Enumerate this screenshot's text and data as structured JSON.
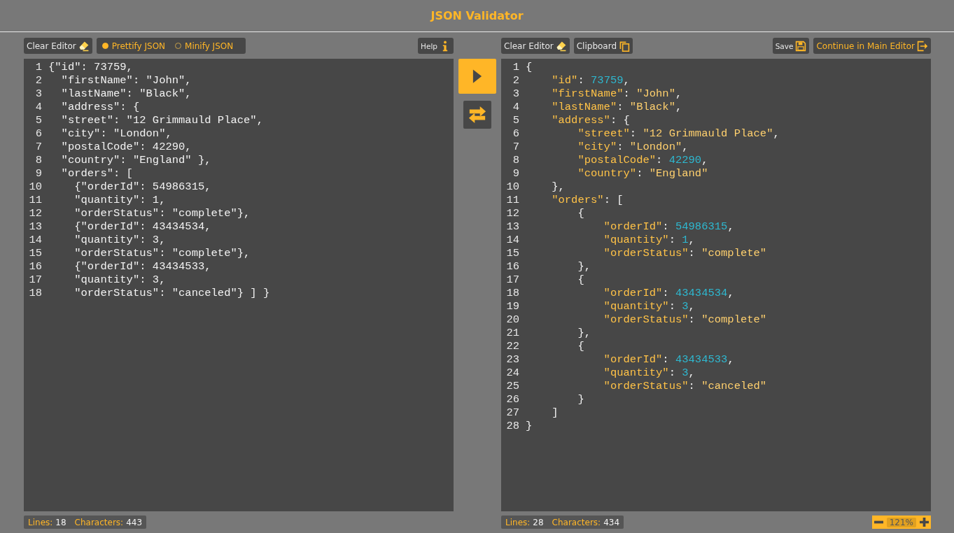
{
  "title": "JSON Validator",
  "left": {
    "toolbar": {
      "clear": "Clear Editor",
      "modes": [
        {
          "label": "Prettify JSON",
          "selected": true
        },
        {
          "label": "Minify JSON",
          "selected": false
        }
      ],
      "help": "Help"
    },
    "lines": [
      "{\"id\": 73759,",
      "  \"firstName\": \"John\",",
      "  \"lastName\": \"Black\",",
      "  \"address\": {",
      "  \"street\": \"12 Grimmauld Place\",",
      "  \"city\": \"London\",",
      "  \"postalCode\": 42290,",
      "  \"country\": \"England\" },",
      "  \"orders\": [",
      "    {\"orderId\": 54986315,",
      "    \"quantity\": 1,",
      "    \"orderStatus\": \"complete\"},",
      "    {\"orderId\": 43434534,",
      "    \"quantity\": 3,",
      "    \"orderStatus\": \"complete\"},",
      "    {\"orderId\": 43434533,",
      "    \"quantity\": 3,",
      "    \"orderStatus\": \"canceled\"} ] }"
    ],
    "line_numbers": [
      "1",
      "2",
      "3",
      "4",
      "5",
      "6",
      "7",
      "8",
      "9",
      "10",
      "11",
      "12",
      "13",
      "14",
      "15",
      "16",
      "17",
      "18"
    ],
    "status": {
      "lines_label": "Lines:",
      "lines": "18",
      "chars_label": "Characters:",
      "chars": "443"
    }
  },
  "right": {
    "toolbar": {
      "clear": "Clear Editor",
      "clipboard": "Clipboard",
      "save": "Save",
      "continue": "Continue in Main Editor"
    },
    "lines": [
      [
        {
          "kind": "punct",
          "text": "{"
        }
      ],
      [
        {
          "kind": "key",
          "text": "    \"id\""
        },
        {
          "kind": "punct",
          "text": ": "
        },
        {
          "kind": "number",
          "text": "73759"
        },
        {
          "kind": "punct",
          "text": ","
        }
      ],
      [
        {
          "kind": "key",
          "text": "    \"firstName\""
        },
        {
          "kind": "punct",
          "text": ": "
        },
        {
          "kind": "string",
          "text": "\"John\""
        },
        {
          "kind": "punct",
          "text": ","
        }
      ],
      [
        {
          "kind": "key",
          "text": "    \"lastName\""
        },
        {
          "kind": "punct",
          "text": ": "
        },
        {
          "kind": "string",
          "text": "\"Black\""
        },
        {
          "kind": "punct",
          "text": ","
        }
      ],
      [
        {
          "kind": "key",
          "text": "    \"address\""
        },
        {
          "kind": "punct",
          "text": ": {"
        }
      ],
      [
        {
          "kind": "key",
          "text": "        \"street\""
        },
        {
          "kind": "punct",
          "text": ": "
        },
        {
          "kind": "string",
          "text": "\"12 Grimmauld Place\""
        },
        {
          "kind": "punct",
          "text": ","
        }
      ],
      [
        {
          "kind": "key",
          "text": "        \"city\""
        },
        {
          "kind": "punct",
          "text": ": "
        },
        {
          "kind": "string",
          "text": "\"London\""
        },
        {
          "kind": "punct",
          "text": ","
        }
      ],
      [
        {
          "kind": "key",
          "text": "        \"postalCode\""
        },
        {
          "kind": "punct",
          "text": ": "
        },
        {
          "kind": "number",
          "text": "42290"
        },
        {
          "kind": "punct",
          "text": ","
        }
      ],
      [
        {
          "kind": "key",
          "text": "        \"country\""
        },
        {
          "kind": "punct",
          "text": ": "
        },
        {
          "kind": "string",
          "text": "\"England\""
        }
      ],
      [
        {
          "kind": "punct",
          "text": "    },"
        }
      ],
      [
        {
          "kind": "key",
          "text": "    \"orders\""
        },
        {
          "kind": "punct",
          "text": ": ["
        }
      ],
      [
        {
          "kind": "punct",
          "text": "        {"
        }
      ],
      [
        {
          "kind": "key",
          "text": "            \"orderId\""
        },
        {
          "kind": "punct",
          "text": ": "
        },
        {
          "kind": "number",
          "text": "54986315"
        },
        {
          "kind": "punct",
          "text": ","
        }
      ],
      [
        {
          "kind": "key",
          "text": "            \"quantity\""
        },
        {
          "kind": "punct",
          "text": ": "
        },
        {
          "kind": "number",
          "text": "1"
        },
        {
          "kind": "punct",
          "text": ","
        }
      ],
      [
        {
          "kind": "key",
          "text": "            \"orderStatus\""
        },
        {
          "kind": "punct",
          "text": ": "
        },
        {
          "kind": "string",
          "text": "\"complete\""
        }
      ],
      [
        {
          "kind": "punct",
          "text": "        },"
        }
      ],
      [
        {
          "kind": "punct",
          "text": "        {"
        }
      ],
      [
        {
          "kind": "key",
          "text": "            \"orderId\""
        },
        {
          "kind": "punct",
          "text": ": "
        },
        {
          "kind": "number",
          "text": "43434534"
        },
        {
          "kind": "punct",
          "text": ","
        }
      ],
      [
        {
          "kind": "key",
          "text": "            \"quantity\""
        },
        {
          "kind": "punct",
          "text": ": "
        },
        {
          "kind": "number",
          "text": "3"
        },
        {
          "kind": "punct",
          "text": ","
        }
      ],
      [
        {
          "kind": "key",
          "text": "            \"orderStatus\""
        },
        {
          "kind": "punct",
          "text": ": "
        },
        {
          "kind": "string",
          "text": "\"complete\""
        }
      ],
      [
        {
          "kind": "punct",
          "text": "        },"
        }
      ],
      [
        {
          "kind": "punct",
          "text": "        {"
        }
      ],
      [
        {
          "kind": "key",
          "text": "            \"orderId\""
        },
        {
          "kind": "punct",
          "text": ": "
        },
        {
          "kind": "number",
          "text": "43434533"
        },
        {
          "kind": "punct",
          "text": ","
        }
      ],
      [
        {
          "kind": "key",
          "text": "            \"quantity\""
        },
        {
          "kind": "punct",
          "text": ": "
        },
        {
          "kind": "number",
          "text": "3"
        },
        {
          "kind": "punct",
          "text": ","
        }
      ],
      [
        {
          "kind": "key",
          "text": "            \"orderStatus\""
        },
        {
          "kind": "punct",
          "text": ": "
        },
        {
          "kind": "string",
          "text": "\"canceled\""
        }
      ],
      [
        {
          "kind": "punct",
          "text": "        }"
        }
      ],
      [
        {
          "kind": "punct",
          "text": "    ]"
        }
      ],
      [
        {
          "kind": "punct",
          "text": "}"
        }
      ]
    ],
    "line_numbers": [
      "1",
      "2",
      "3",
      "4",
      "5",
      "6",
      "7",
      "8",
      "9",
      "10",
      "11",
      "12",
      "13",
      "14",
      "15",
      "16",
      "17",
      "18",
      "19",
      "20",
      "21",
      "22",
      "23",
      "24",
      "25",
      "26",
      "27",
      "28"
    ],
    "status": {
      "lines_label": "Lines:",
      "lines": "28",
      "chars_label": "Characters:",
      "chars": "434"
    },
    "zoom": "121%"
  }
}
